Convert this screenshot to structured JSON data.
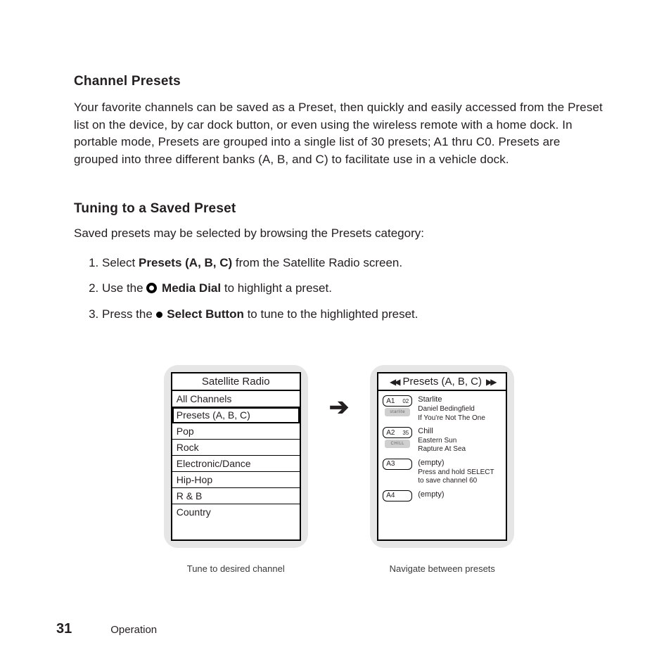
{
  "sec1": {
    "heading": "Channel Presets",
    "body": "Your favorite channels can be saved as a Preset, then quickly and easily accessed from the Preset list on the device, by car dock button, or even using the wireless remote with a home dock. In portable mode, Presets are grouped into a single list of 30 presets; A1 thru C0. Presets are grouped into three different banks (A, B, and C) to facilitate use in a vehicle dock."
  },
  "sec2": {
    "heading": "Tuning to a Saved Preset",
    "lead": "Saved presets may be selected by browsing the Presets category:",
    "steps": {
      "s1a": "Select ",
      "s1b": "Presets (A, B, C)",
      "s1c": " from the Satellite Radio screen.",
      "s2a": "Use the ",
      "s2b": " Media Dial",
      "s2c": " to highlight a preset.",
      "s3a": "Press the ",
      "s3b": " Select Button",
      "s3c": " to tune to the highlighted preset."
    }
  },
  "left_screen": {
    "title": "Satellite Radio",
    "items": [
      "All Channels",
      "Presets (A, B, C)",
      "Pop",
      "Rock",
      "Electronic/Dance",
      "Hip-Hop",
      "R & B",
      "Country"
    ]
  },
  "right_screen": {
    "title": "Presets (A, B, C)",
    "rows": [
      {
        "slot": "A1",
        "chan": "02",
        "logo": "starlite",
        "line1": "Starlite",
        "line2": "Daniel Bedingfield",
        "line3": "If You're Not The One"
      },
      {
        "slot": "A2",
        "chan": "35",
        "logo": "CHILL",
        "line1": "Chill",
        "line2": "Eastern Sun",
        "line3": "Rapture At Sea"
      },
      {
        "slot": "A3",
        "chan": "",
        "logo": "",
        "line1": "(empty)",
        "line2": "Press and hold SELECT",
        "line3": "to save channel 60"
      },
      {
        "slot": "A4",
        "chan": "",
        "logo": "",
        "line1": "(empty)",
        "line2": "",
        "line3": ""
      }
    ]
  },
  "captions": {
    "left": "Tune to desired channel",
    "right": "Navigate between presets"
  },
  "footer": {
    "page": "31",
    "section": "Operation"
  }
}
